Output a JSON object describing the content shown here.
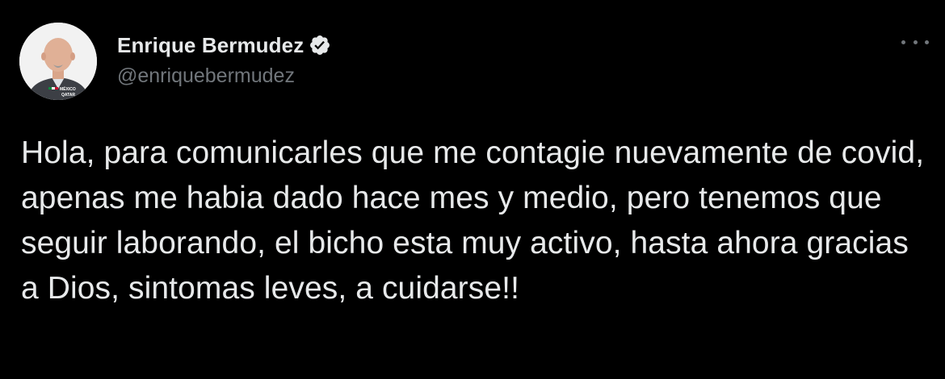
{
  "author": {
    "display_name": "Enrique Bermudez",
    "handle": "@enriquebermudez",
    "verified_icon": "verified-badge-icon",
    "avatar_badge_text": [
      "MÉXICO",
      "QATAR"
    ]
  },
  "tweet": {
    "text": "Hola, para comunicarles que me contagie nuevamente de covid, apenas me habia dado hace mes y medio, pero tenemos que seguir laborando, el bicho esta muy activo, hasta ahora gracias a Dios, sintomas leves, a cuidarse!!"
  },
  "menu": {
    "icon": "more-options-icon"
  },
  "colors": {
    "background": "#000000",
    "primary_text": "#e7e9ea",
    "secondary_text": "#71767b"
  }
}
